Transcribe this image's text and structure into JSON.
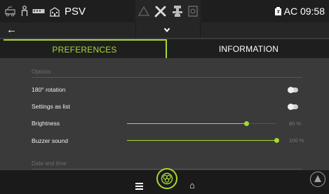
{
  "status_bar": {
    "app_name": "PSV",
    "clock": "AC 09:58",
    "left_icons": [
      "machine-icon",
      "bus-icon",
      "building-icon"
    ],
    "center_icons": [
      "warning-triangle-icon",
      "tools-icon",
      "fan-icon",
      "ventilation-icon"
    ],
    "battery_icon": "battery-plug-icon"
  },
  "tabs": [
    {
      "label": "PREFERENCES",
      "active": true
    },
    {
      "label": "INFORMATION",
      "active": false
    }
  ],
  "options": {
    "section_title": "Options",
    "rows": [
      {
        "label": "180° rotation",
        "type": "toggle"
      },
      {
        "label": "Settings as list",
        "type": "toggle"
      },
      {
        "label": "Brightness",
        "type": "slider",
        "value": 80,
        "value_label": "80 %"
      },
      {
        "label": "Buzzer sound",
        "type": "slider",
        "value": 100,
        "value_label": "100 %"
      }
    ]
  },
  "date_time": {
    "section_title": "Date and time"
  },
  "colors": {
    "accent": "#a8d832",
    "background": "#3a3a3a",
    "bar": "#1e1e1e"
  }
}
